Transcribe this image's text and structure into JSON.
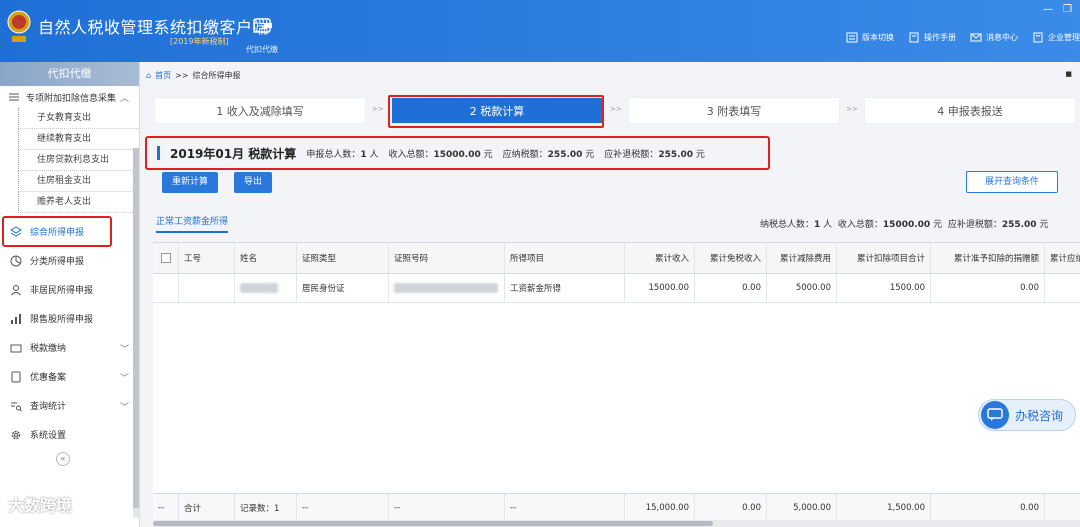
{
  "header": {
    "title": "自然人税收管理系统扣缴客户端",
    "badge": "[2019年新税制]",
    "subtitle": "代扣代缴",
    "nav": [
      "版本切换",
      "操作手册",
      "消息中心",
      "企业管理"
    ]
  },
  "sidebar": {
    "header": "代扣代缴",
    "group": "专项附加扣除信息采集",
    "sub_items": [
      "子女教育支出",
      "继续教育支出",
      "住房贷款利息支出",
      "住房租金支出",
      "赡养老人支出"
    ],
    "items": [
      {
        "label": "综合所得申报",
        "icon": "layers-icon",
        "active": true
      },
      {
        "label": "分类所得申报",
        "icon": "pie-icon"
      },
      {
        "label": "非居民所得申报",
        "icon": "user-icon"
      },
      {
        "label": "限售股所得申报",
        "icon": "bars-icon"
      },
      {
        "label": "税款缴纳",
        "icon": "folder-icon",
        "chevron": true
      },
      {
        "label": "优惠备案",
        "icon": "file-icon",
        "chevron": true
      },
      {
        "label": "查询统计",
        "icon": "search-list-icon",
        "chevron": true
      },
      {
        "label": "系统设置",
        "icon": "gear-icon"
      }
    ]
  },
  "breadcrumb": {
    "home": "首页",
    "sep": ">>",
    "current": "综合所得申报"
  },
  "steps": [
    "1 收入及减除填写",
    "2 税款计算",
    "3 附表填写",
    "4 申报表报送"
  ],
  "summary": {
    "period": "2019年01月",
    "title": "税款计算",
    "people_label": "申报总人数：",
    "people_value": "1",
    "people_unit": "人",
    "income_label": "收入总额：",
    "income_value": "15000.00",
    "income_unit": "元",
    "tax_label": "应纳税额：",
    "tax_value": "255.00",
    "tax_unit": "元",
    "refund_label": "应补退税额：",
    "refund_value": "255.00",
    "refund_unit": "元"
  },
  "buttons": {
    "recalc": "重新计算",
    "export": "导出",
    "expand": "展开查询条件"
  },
  "subtab": "正常工资薪金所得",
  "right_summary": {
    "people": "纳税总人数：",
    "people_value": "1",
    "people_unit": "人",
    "income": "收入总额：",
    "income_value": "15000.00",
    "income_unit": "元",
    "refund": "应补退税额：",
    "refund_value": "255.00",
    "refund_unit": "元"
  },
  "table": {
    "headers": [
      "工号",
      "姓名",
      "证照类型",
      "证照号码",
      "所得项目",
      "累计收入",
      "累计免税收入",
      "累计减除费用",
      "累计扣除项目合计",
      "累计准予扣除的捐赠额",
      "累计应纳"
    ],
    "row": {
      "id_type": "居民身份证",
      "item": "工资薪金所得",
      "income": "15000.00",
      "exempt": "0.00",
      "deduct": "5000.00",
      "deduct_total": "1500.00",
      "donation": "0.00"
    },
    "footer": {
      "dash": "--",
      "total": "合计",
      "records": "记录数：1",
      "d1": "--",
      "d2": "--",
      "d3": "--",
      "income": "15,000.00",
      "exempt": "0.00",
      "deduct": "5,000.00",
      "deduct_total": "1,500.00",
      "donation": "0.00"
    }
  },
  "chat": "办税咨询",
  "watermark": "大数跨境",
  "colors": {
    "primary": "#1f6fd6",
    "highlight": "#e02020"
  }
}
